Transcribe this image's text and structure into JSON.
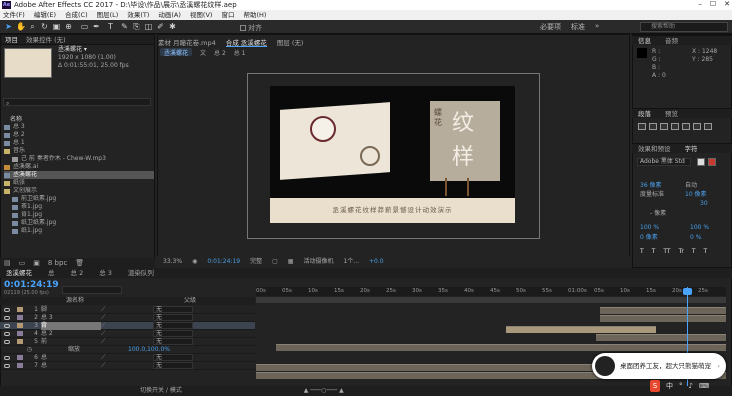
{
  "window": {
    "title": "Adobe After Effects CC 2017 - D:\\毕设\\作品\\展示\\丞溪螺花纹样.aep",
    "app_badge": "Ae"
  },
  "menu": [
    "文件(F)",
    "编辑(E)",
    "合成(C)",
    "图层(L)",
    "效果(T)",
    "动画(A)",
    "视图(V)",
    "窗口",
    "帮助(H)"
  ],
  "toolbar": {
    "align_label": "对齐",
    "workspace": "必要项",
    "standard": "标准",
    "search_placeholder": "搜索帮助"
  },
  "project": {
    "tabs": [
      "项目",
      "效果控件 (无)"
    ],
    "selected_name": "丞溪螺花 ▾",
    "info_lines": [
      "1920 x 1080 (1.00)",
      "Δ 0:01:55:01, 25.00 fps"
    ],
    "column_header": "名称",
    "items": [
      {
        "name": "总 3",
        "type": "comp"
      },
      {
        "name": "总 2",
        "type": "comp"
      },
      {
        "name": "总 1",
        "type": "comp"
      },
      {
        "name": "音乐",
        "type": "folder"
      },
      {
        "name": "己 前 奏者乔木 - Chew-W.mp3",
        "type": "audio"
      },
      {
        "name": "丞溪螺.ai",
        "type": "file"
      },
      {
        "name": "丞溪螺花",
        "type": "comp",
        "selected": true
      },
      {
        "name": "纸张",
        "type": "folder"
      },
      {
        "name": "文创展示",
        "type": "folder"
      },
      {
        "name": "前卫纸素.jpg",
        "type": "image"
      },
      {
        "name": "茶1.jpg",
        "type": "image"
      },
      {
        "name": "肯1.jpg",
        "type": "image"
      },
      {
        "name": "纸卫纸素.jpg",
        "type": "image"
      },
      {
        "name": "纸1.jpg",
        "type": "image"
      },
      {
        "name": "纸1.jpg",
        "type": "image"
      }
    ],
    "footer": "8 bpc"
  },
  "viewer": {
    "tabs": [
      "素材 月瞳花卷.mp4",
      "合成 丞溪螺花",
      "图层 (无)"
    ],
    "breadcrumbs": [
      "丞溪螺花",
      "文",
      "总 2",
      "总 1"
    ],
    "canvas_caption": "丞溪螺花纹样莽薪景憾设计动效演示",
    "big_chars": [
      "纹",
      "样",
      "螺",
      "花"
    ],
    "footer": {
      "zoom": "33.3%",
      "timecode": "0:01:24:19",
      "quality": "完整",
      "camera": "活动摄像机",
      "views": "1个...",
      "exposure": "+0.0"
    }
  },
  "right": {
    "tabs_top": [
      "信息",
      "音频"
    ],
    "info": {
      "r": "R :",
      "g": "G :",
      "b": "B :",
      "a": "A : 0",
      "x": "X : 1248",
      "y": "Y : 285"
    },
    "tabs_mid": [
      "段落",
      "预览"
    ],
    "tabs_low": [
      "效果和预设",
      "字符"
    ],
    "font": "Adobe 黑体 Std",
    "font_size": "36 像素",
    "leading": "自动",
    "tracking": "10 像素",
    "kerning": "度量标准",
    "tracking2": "30",
    "unit": "- 像素",
    "scale_v": "100 %",
    "scale_h": "100 %",
    "baseline": "0 像素",
    "tsume": "0 %",
    "styles": [
      "T",
      "T",
      "TT",
      "Tr",
      "T",
      "T"
    ]
  },
  "timeline": {
    "tabs": [
      "丞溪螺花",
      "总",
      "总 2",
      "总 3",
      "渲染队列"
    ],
    "timecode": "0:01:24:19",
    "fps_label": "02119 (25.00 fps)",
    "col_source": "源名称",
    "col_parent": "父级",
    "ruler": [
      "00s",
      "05s",
      "10s",
      "15s",
      "20s",
      "25s",
      "30s",
      "35s",
      "40s",
      "45s",
      "50s",
      "55s",
      "01:00s",
      "05s",
      "10s",
      "15s",
      "20s",
      "25s"
    ],
    "layers": [
      {
        "num": "1",
        "name": "脚",
        "parent": "无",
        "color": "#b39a74"
      },
      {
        "num": "2",
        "name": "总 3",
        "parent": "无",
        "color": "#8a7d9a"
      },
      {
        "num": "3",
        "name": "背",
        "parent": "无",
        "color": "#b39a74",
        "selected": true
      },
      {
        "num": "4",
        "name": "总 2",
        "parent": "无",
        "color": "#8a7d9a"
      },
      {
        "num": "5",
        "name": "前",
        "parent": "无",
        "color": "#b39a74"
      },
      {
        "num": "",
        "name": "缩放",
        "parent": "",
        "value": "100.0,100.0%"
      },
      {
        "num": "6",
        "name": "总",
        "parent": "无",
        "color": "#8a7d9a"
      },
      {
        "num": "7",
        "name": "总",
        "parent": "无",
        "color": "#8a7d9a"
      }
    ],
    "footer": "切换开关 / 模式"
  },
  "notification": {
    "text": "桌面团养工友，超大只熊猫萌宠"
  },
  "ime": {
    "logo": "S",
    "label": "中"
  }
}
